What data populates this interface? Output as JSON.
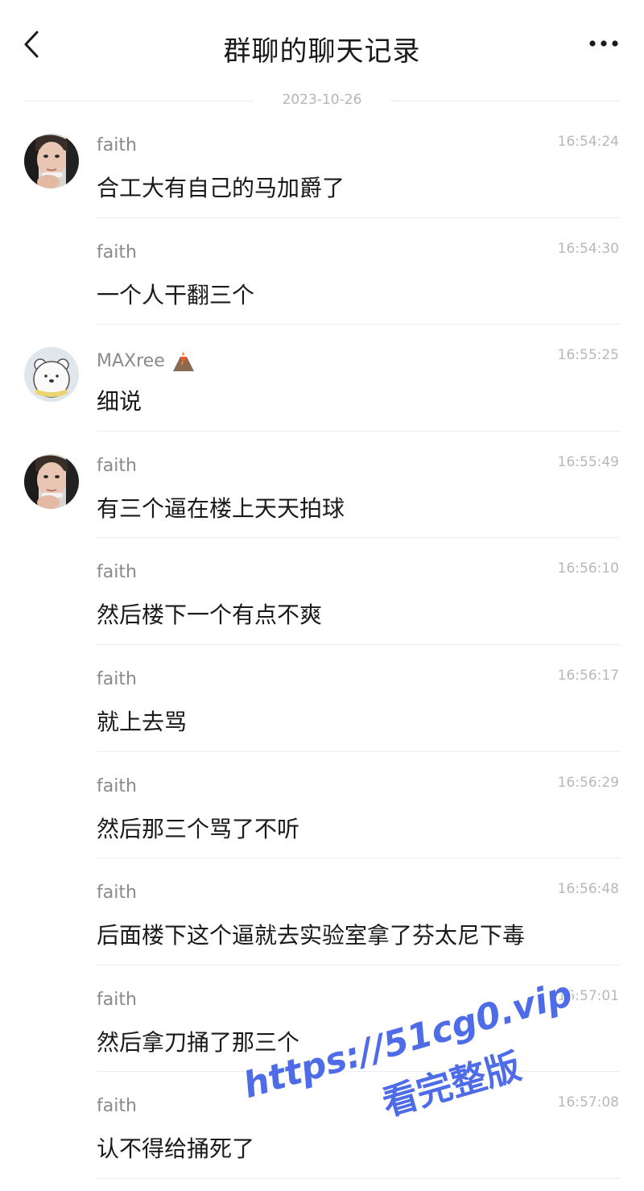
{
  "header": {
    "title": "群聊的聊天记录",
    "back_icon": "chevron-left-icon",
    "more_icon": "more-horizontal-icon"
  },
  "date": "2023-10-26",
  "messages": [
    {
      "sender": "faith",
      "time": "16:54:24",
      "text": "合工大有自己的马加爵了",
      "avatar": "faith"
    },
    {
      "sender": "faith",
      "time": "16:54:30",
      "text": "一个人干翻三个",
      "avatar": ""
    },
    {
      "sender": "MAXree",
      "time": "16:55:25",
      "text": "细说",
      "avatar": "bear",
      "badge_icon": "volcano-icon"
    },
    {
      "sender": "faith",
      "time": "16:55:49",
      "text": "有三个逼在楼上天天拍球",
      "avatar": "faith"
    },
    {
      "sender": "faith",
      "time": "16:56:10",
      "text": "然后楼下一个有点不爽",
      "avatar": ""
    },
    {
      "sender": "faith",
      "time": "16:56:17",
      "text": "就上去骂",
      "avatar": ""
    },
    {
      "sender": "faith",
      "time": "16:56:29",
      "text": "然后那三个骂了不听",
      "avatar": ""
    },
    {
      "sender": "faith",
      "time": "16:56:48",
      "text": "后面楼下这个逼就去实验室拿了芬太尼下毒",
      "avatar": ""
    },
    {
      "sender": "faith",
      "time": "16:57:01",
      "text": "然后拿刀捅了那三个",
      "avatar": ""
    },
    {
      "sender": "faith",
      "time": "16:57:08",
      "text": "认不得给捅死了",
      "avatar": ""
    }
  ],
  "watermark": {
    "line1": "https://51cg0.vip",
    "line2": "看完整版",
    "color": "#4f6ce8"
  }
}
